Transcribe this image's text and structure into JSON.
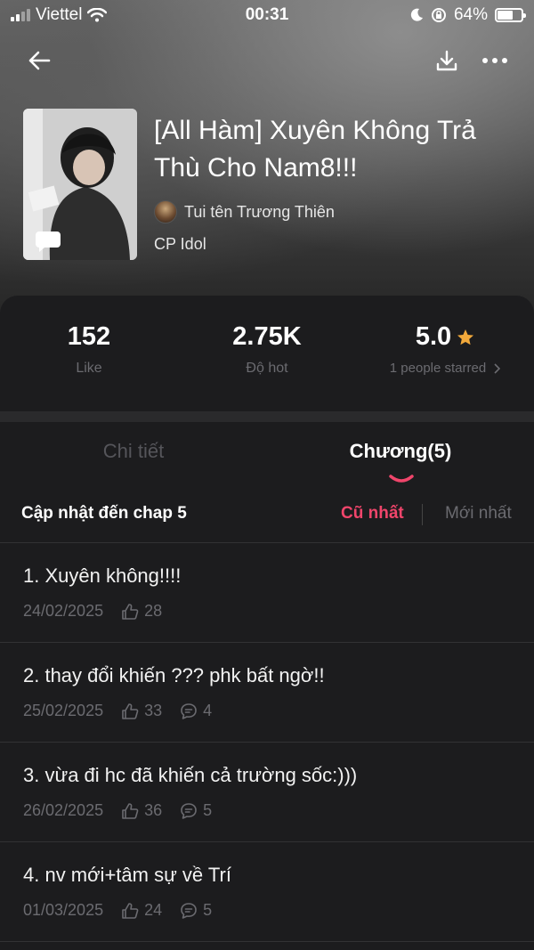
{
  "status_bar": {
    "carrier": "Viettel",
    "time": "00:31",
    "battery": "64%",
    "battery_level": 0.64
  },
  "book": {
    "title": "[All Hàm] Xuyên Không Trả Thù Cho Nam8!!!",
    "author": "Tui tên Trương Thiên",
    "category": "CP Idol"
  },
  "stats": {
    "likes_value": "152",
    "likes_label": "Like",
    "hot_value": "2.75K",
    "hot_label": "Độ hot",
    "rating_value": "5.0",
    "rating_label": "1 people starred",
    "accent_color": "#f2a93b"
  },
  "tabs": [
    {
      "label": "Chi tiết",
      "active": false
    },
    {
      "label": "Chương(5)",
      "active": true
    }
  ],
  "chapters_header": {
    "update_label": "Cập nhật đến chap 5",
    "sort_oldest": "Cũ nhất",
    "sort_newest": "Mới nhất"
  },
  "chapters": [
    {
      "title": "1. Xuyên không!!!!",
      "date": "24/02/2025",
      "likes": "28",
      "comments": ""
    },
    {
      "title": "2. thay đổi khiến ??? phk bất ngờ!!",
      "date": "25/02/2025",
      "likes": "33",
      "comments": "4"
    },
    {
      "title": "3. vừa đi hc đã khiến cả trường sốc:)))",
      "date": "26/02/2025",
      "likes": "36",
      "comments": "5"
    },
    {
      "title": "4. nv mới+tâm sự về Trí",
      "date": "01/03/2025",
      "likes": "24",
      "comments": "5"
    }
  ],
  "colors": {
    "accent_pink": "#f0456b",
    "star": "#f2a93b",
    "muted": "#6b6b70"
  },
  "icons": [
    "back-arrow-icon",
    "download-icon",
    "more-icon",
    "star-icon",
    "chevron-right-icon",
    "like-icon",
    "comment-icon",
    "wifi-icon",
    "moon-icon",
    "lock-rotation-icon",
    "battery-icon",
    "signal-icon"
  ]
}
